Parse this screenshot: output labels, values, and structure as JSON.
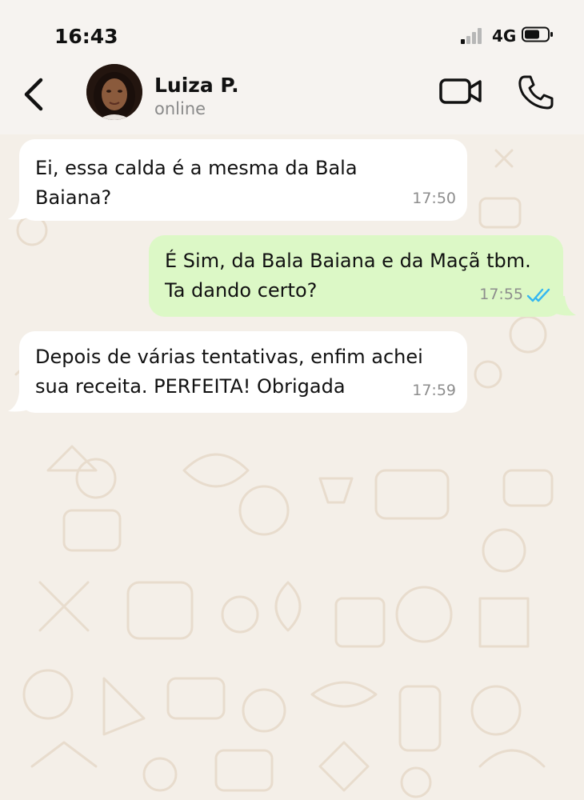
{
  "status_bar": {
    "time": "16:43",
    "network": "4G"
  },
  "header": {
    "contact_name": "Luiza P.",
    "contact_status": "online"
  },
  "messages": [
    {
      "direction": "incoming",
      "text": "Ei, essa calda é a mesma da Bala\nBaiana?",
      "time": "17:50"
    },
    {
      "direction": "outgoing",
      "text": "É Sim, da Bala Baiana e da Maçã tbm.\nTa dando certo?",
      "time": "17:55",
      "read": true
    },
    {
      "direction": "incoming",
      "text": "Depois de várias tentativas, enfim achei\nsua receita. PERFEITA! Obrigada",
      "time": "17:59"
    }
  ],
  "colors": {
    "incoming_bubble": "#ffffff",
    "outgoing_bubble": "#dcf8c6",
    "read_ticks": "#34b7f1",
    "wallpaper": "#f4efe8"
  }
}
